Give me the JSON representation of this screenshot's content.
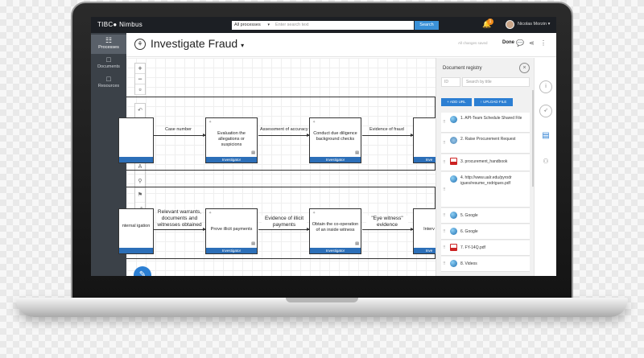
{
  "topbar": {
    "brand": "TIBC● Nimbus",
    "scope_select": "All processes",
    "search_placeholder": "Enter search text",
    "search_button": "Search",
    "notification_count": "1",
    "user_name": "Nicolas Morzin"
  },
  "leftnav": {
    "items": [
      {
        "label": "Processes",
        "icon": "sitemap-icon",
        "glyph": "☷"
      },
      {
        "label": "Documents",
        "icon": "document-icon",
        "glyph": "□"
      },
      {
        "label": "Resources",
        "icon": "folder-icon",
        "glyph": "□"
      }
    ]
  },
  "titlebar": {
    "title": "Investigate Fraud",
    "title_caret": "▾",
    "saved_text": "All changes saved",
    "done_label": "Done"
  },
  "canvas": {
    "zoom_in": "+",
    "zoom_out": "−",
    "lane1": {
      "arrow_labels": [
        "Case number",
        "Assessment of accuracy",
        "Evidence of fraud"
      ],
      "boxes": [
        {
          "text": "",
          "role": ""
        },
        {
          "text": "Evaluation the allegations or suspicions",
          "role": "Investigator"
        },
        {
          "text": "Conduct due diligence background checks",
          "role": "Investigator"
        },
        {
          "text": "",
          "role": "Inve"
        }
      ]
    },
    "lane2": {
      "arrow_labels": [
        "Relevant warrants, documents and witnesses obtained",
        "Evidence of illicit payments",
        "\"Eye witness\" evidence"
      ],
      "boxes": [
        {
          "text": "nternal igation",
          "role": ""
        },
        {
          "text": "Prove illicit payments",
          "role": "Investigator"
        },
        {
          "text": "Obtain the co-operation of an inside witness",
          "role": "Investigator"
        },
        {
          "text": "Interv",
          "role": "Inve"
        }
      ]
    },
    "fab_icon": "✎"
  },
  "panel": {
    "title": "Document registry",
    "close": "×",
    "id_placeholder": "ID",
    "filter_placeholder": "Search by title",
    "add_url": "+ ADD URL",
    "upload_file": "↑ UPLOAD FILE",
    "items": [
      {
        "text": "1. API-Team Schedule Shared File",
        "type": "globe"
      },
      {
        "text": "2. Raise Procurement Request",
        "type": "workflow"
      },
      {
        "text": "3. procurement_handbook",
        "type": "pdf"
      },
      {
        "text": "4. http://www.uaIr.edu/pyrodr igues/resume_rodrigues.pdf",
        "type": "globe"
      },
      {
        "text": "5. Google",
        "type": "globe"
      },
      {
        "text": "6. Google",
        "type": "globe"
      },
      {
        "text": "7. FY-14Q.pdf",
        "type": "pdf"
      },
      {
        "text": "8. Videos",
        "type": "globe"
      }
    ]
  },
  "colors": {
    "accent": "#2c7fd3",
    "topbar": "#1c1f24",
    "leftnav": "#3b4148",
    "badge": "#f08c1a"
  }
}
